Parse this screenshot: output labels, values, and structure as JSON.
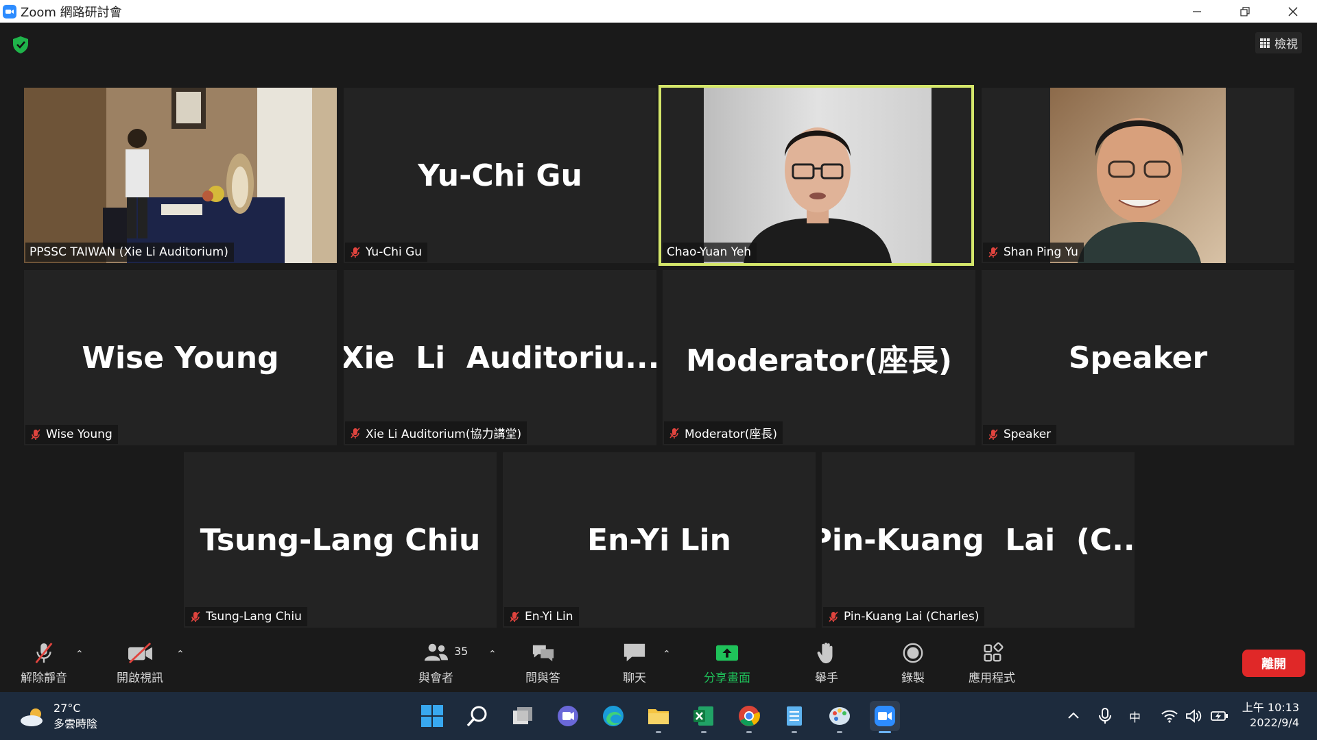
{
  "window": {
    "title": "Zoom 網路研討會"
  },
  "view_button": {
    "label": "檢視"
  },
  "tiles": [
    {
      "type": "video",
      "label": "PPSSC TAIWAN (Xie Li Auditorium)",
      "muted": false
    },
    {
      "type": "name",
      "display": "Yu-Chi Gu",
      "label": "Yu-Chi Gu",
      "muted": true
    },
    {
      "type": "video",
      "label": "Chao-Yuan Yeh",
      "muted": false,
      "active": true
    },
    {
      "type": "video",
      "label": "Shan Ping Yu",
      "muted": true
    },
    {
      "type": "name",
      "display": "Wise Young",
      "label": "Wise Young",
      "muted": true
    },
    {
      "type": "name",
      "display": "Xie  Li  Auditoriu...",
      "label": "Xie Li Auditorium(協力講堂)",
      "muted": true
    },
    {
      "type": "name",
      "display": "Moderator(座長)",
      "label": "Moderator(座長)",
      "muted": true
    },
    {
      "type": "name",
      "display": "Speaker",
      "label": "Speaker",
      "muted": true
    },
    {
      "type": "name",
      "display": "Tsung-Lang Chiu",
      "label": "Tsung-Lang Chiu",
      "muted": true
    },
    {
      "type": "name",
      "display": "En-Yi Lin",
      "label": "En-Yi Lin",
      "muted": true
    },
    {
      "type": "name",
      "display": "Pin-Kuang  Lai  (C...",
      "label": "Pin-Kuang Lai (Charles)",
      "muted": true
    }
  ],
  "toolbar": {
    "unmute": "解除靜音",
    "start_video": "開啟視訊",
    "participants": "與會者",
    "participants_count": "35",
    "qa": "問與答",
    "chat": "聊天",
    "share_screen": "分享畫面",
    "raise_hand": "舉手",
    "record": "錄製",
    "apps": "應用程式",
    "leave": "離開"
  },
  "taskbar": {
    "weather_temp": "27°C",
    "weather_condition": "多雲時陰",
    "ime": "中",
    "time": "上午 10:13",
    "date": "2022/9/4"
  },
  "colors": {
    "active_speaker": "#d4e66a",
    "share_green": "#1fc25a",
    "leave_red": "#e02828",
    "muted_red": "#e0443e"
  }
}
